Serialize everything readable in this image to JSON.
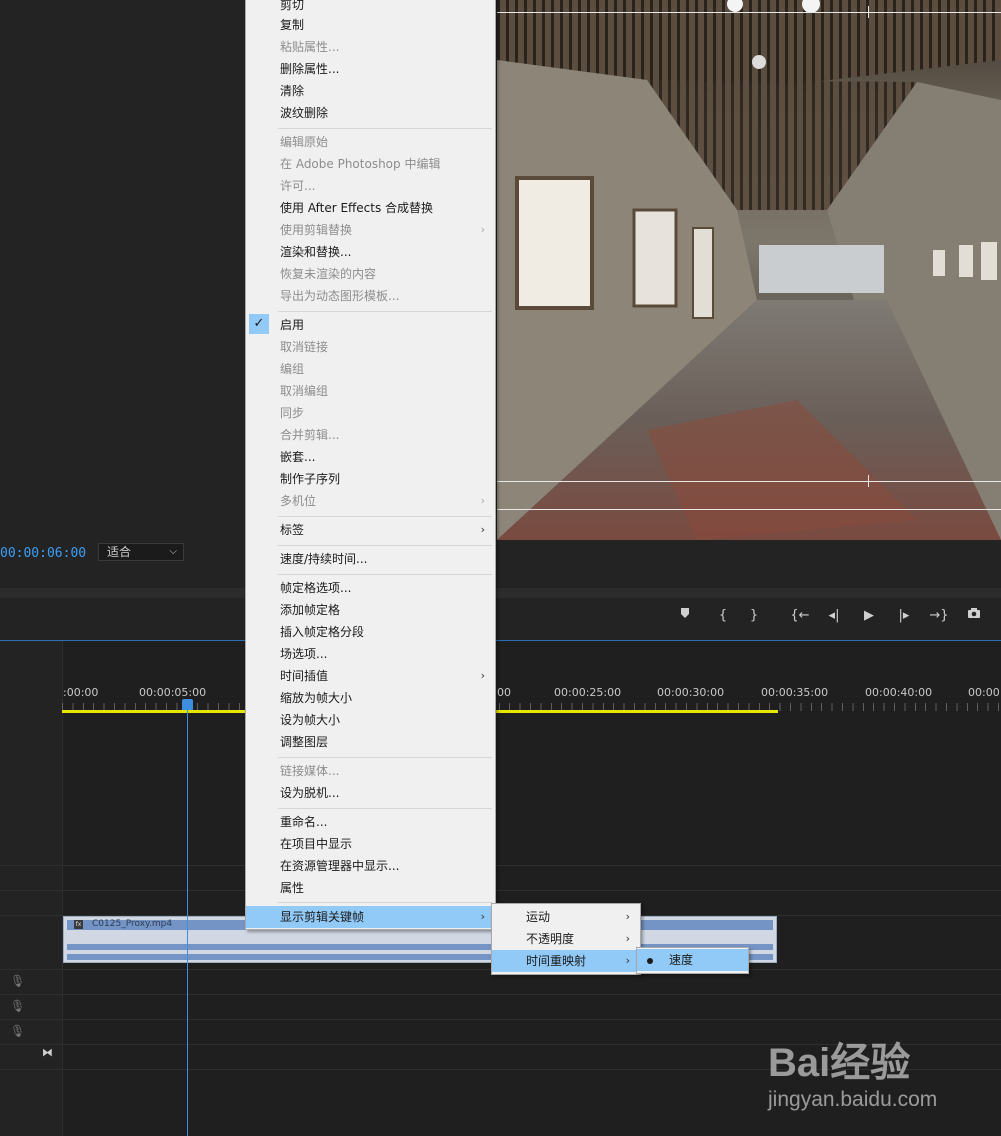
{
  "context_menu": {
    "items": [
      {
        "label": "剪切",
        "disabled": false
      },
      {
        "label": "复制",
        "disabled": false
      },
      {
        "label": "粘贴属性...",
        "disabled": true
      },
      {
        "label": "删除属性...",
        "disabled": false
      },
      {
        "label": "清除",
        "disabled": false
      },
      {
        "label": "波纹删除",
        "disabled": false
      },
      {
        "label": "编辑原始",
        "disabled": true
      },
      {
        "label": "在 Adobe Photoshop 中编辑",
        "disabled": true
      },
      {
        "label": "许可...",
        "disabled": true
      },
      {
        "label": "使用 After Effects 合成替换",
        "disabled": false
      },
      {
        "label": "使用剪辑替换",
        "disabled": true,
        "submenu": true
      },
      {
        "label": "渲染和替换...",
        "disabled": false
      },
      {
        "label": "恢复未渲染的内容",
        "disabled": true
      },
      {
        "label": "导出为动态图形模板...",
        "disabled": true
      },
      {
        "label": "启用",
        "disabled": false,
        "checked": true
      },
      {
        "label": "取消链接",
        "disabled": true
      },
      {
        "label": "编组",
        "disabled": true
      },
      {
        "label": "取消编组",
        "disabled": true
      },
      {
        "label": "同步",
        "disabled": true
      },
      {
        "label": "合并剪辑...",
        "disabled": true
      },
      {
        "label": "嵌套...",
        "disabled": false
      },
      {
        "label": "制作子序列",
        "disabled": false
      },
      {
        "label": "多机位",
        "disabled": true,
        "submenu": true
      },
      {
        "label": "标签",
        "disabled": false,
        "submenu": true
      },
      {
        "label": "速度/持续时间...",
        "disabled": false
      },
      {
        "label": "帧定格选项...",
        "disabled": false
      },
      {
        "label": "添加帧定格",
        "disabled": false
      },
      {
        "label": "插入帧定格分段",
        "disabled": false
      },
      {
        "label": "场选项...",
        "disabled": false
      },
      {
        "label": "时间插值",
        "disabled": false,
        "submenu": true
      },
      {
        "label": "缩放为帧大小",
        "disabled": false
      },
      {
        "label": "设为帧大小",
        "disabled": false
      },
      {
        "label": "调整图层",
        "disabled": false
      },
      {
        "label": "链接媒体...",
        "disabled": true
      },
      {
        "label": "设为脱机...",
        "disabled": false
      },
      {
        "label": "重命名...",
        "disabled": false
      },
      {
        "label": "在项目中显示",
        "disabled": false
      },
      {
        "label": "在资源管理器中显示...",
        "disabled": false
      },
      {
        "label": "属性",
        "disabled": false
      },
      {
        "label": "显示剪辑关键帧",
        "disabled": false,
        "submenu": true,
        "highlighted": true
      }
    ],
    "check_mark": "✓",
    "submenu_arrow": "›"
  },
  "submenu_keyframes": {
    "items": [
      {
        "label": "运动",
        "highlighted": false
      },
      {
        "label": "不透明度",
        "highlighted": false
      },
      {
        "label": "时间重映射",
        "highlighted": true
      }
    ]
  },
  "submenu_time_remap": {
    "items": [
      {
        "label": "速度",
        "selected": true
      }
    ]
  },
  "monitor": {
    "timecode": "00:00:06:00",
    "fit_value": "适合"
  },
  "timeline": {
    "ruler_labels": [
      ":00:00",
      "00:00:05:00",
      "00",
      "00:00:25:00",
      "00:00:30:00",
      "00:00:35:00",
      "00:00:40:00",
      "00:00:4"
    ],
    "clip_name": "C0125_Proxy.mp4",
    "clip_fx": "fx"
  },
  "transport": {
    "buttons": [
      "add-marker-icon",
      "mark-in-icon",
      "mark-out-icon",
      "go-to-in-icon",
      "step-back-icon",
      "play-icon",
      "step-forward-icon",
      "go-to-out-icon",
      "export-frame-icon"
    ]
  },
  "watermark": {
    "brand": "Bai经验",
    "url": "jingyan.baidu.com"
  },
  "colors": {
    "menu_bg": "#f0f0f0",
    "menu_highlight": "#91c9f7",
    "accent_blue": "#3d9ef6",
    "work_area": "#e7e600",
    "clip": "#7494c6"
  }
}
